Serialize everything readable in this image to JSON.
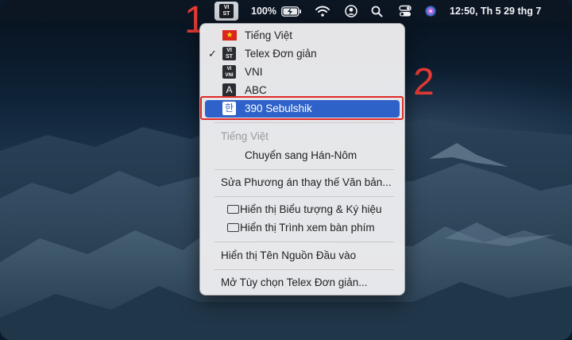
{
  "menubar": {
    "input_badge_top": "VI",
    "input_badge_bottom": "ST",
    "battery_percent": "100%",
    "clock": "12:50, Th 5 29 thg 7",
    "icons": [
      "input-source-icon",
      "battery-charging-icon",
      "wifi-icon",
      "user-icon",
      "search-icon",
      "control-center-icon",
      "siri-icon"
    ]
  },
  "annotations": {
    "step1": "1",
    "step2": "2"
  },
  "menu": {
    "sources": [
      {
        "label": "Tiếng Việt",
        "icon": "vietnam-flag-icon",
        "checked": false
      },
      {
        "label": "Telex Đơn giản",
        "icon": "vist-icon",
        "checked": true,
        "icon_top": "VI",
        "icon_bottom": "ST"
      },
      {
        "label": "VNI",
        "icon": "vni-icon",
        "checked": false,
        "icon_top": "VI",
        "icon_bottom": "VNI"
      },
      {
        "label": "ABC",
        "icon": "abc-icon",
        "checked": false,
        "icon_glyph": "A"
      },
      {
        "label": "390 Sebulshik",
        "icon": "hangul-icon",
        "checked": false,
        "selected": true,
        "icon_glyph": "한"
      }
    ],
    "section_header": "Tiếng Việt",
    "convert_label": "Chuyển sang Hán-Nôm",
    "text_replacement_label": "Sửa Phương án thay thế Văn bản...",
    "show_emoji_label": "Hiển thị Biểu tượng & Ký hiệu",
    "show_keyboard_label": "Hiển thị Trình xem bàn phím",
    "show_input_name_label": "Hiển thị Tên Nguồn Đầu vào",
    "open_prefs_label": "Mở Tùy chọn Telex Đơn giản...",
    "check_glyph": "✓"
  },
  "colors": {
    "highlight_blue": "#2f62c9",
    "annotation_red": "#e23a34",
    "menubar_bg": "#0c1522"
  }
}
